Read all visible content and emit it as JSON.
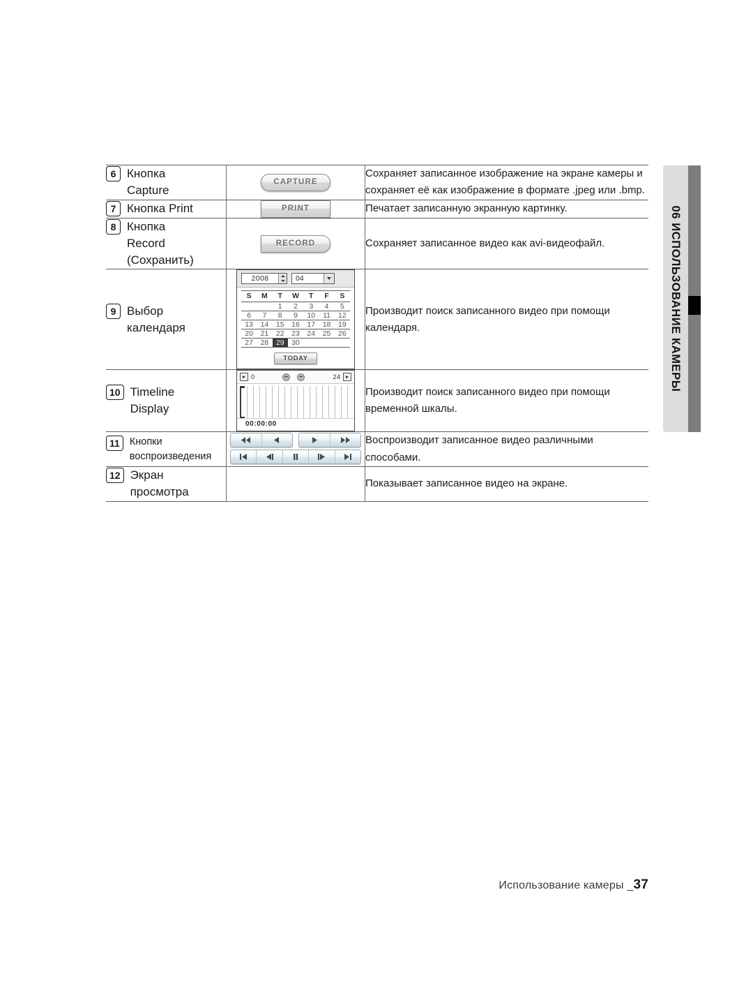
{
  "side_tab": {
    "chapter_number": "06",
    "chapter_title": "ИСПОЛЬЗОВАНИЕ КАМЕРЫ",
    "full_label": "06  ИСПОЛЬЗОВАНИЕ КАМЕРЫ",
    "tab_color": "#dcdcdc",
    "bar_color": "#7d7d7d",
    "marker_color": "#000000"
  },
  "table": {
    "rows": [
      {
        "number": "6",
        "label_lines": [
          "Кнопка",
          "Capture"
        ],
        "visual": "capture-button",
        "button_label": "CAPTURE",
        "description": "Сохраняет записанное изображение на экране камеры и сохраняет её как изображение в формате .jpeg или .bmp."
      },
      {
        "number": "7",
        "label_lines": [
          "Кнопка Print"
        ],
        "visual": "print-button",
        "button_label": "PRINT",
        "description": "Печатает записанную экранную картинку."
      },
      {
        "number": "8",
        "label_lines": [
          "Кнопка",
          "Record",
          "(Сохранить)"
        ],
        "visual": "record-button",
        "button_label": "RECORD",
        "description": "Сохраняет записанное видео как avi-видеофайл."
      },
      {
        "number": "9",
        "label_lines": [
          "Выбор",
          "календаря"
        ],
        "visual": "calendar-widget",
        "description": "Производит поиск записанного видео при помощи календаря."
      },
      {
        "number": "10",
        "label_lines": [
          "Timeline",
          "Display"
        ],
        "visual": "timeline-widget",
        "description": "Производит поиск записанного видео при помощи временной шкалы."
      },
      {
        "number": "11",
        "label_lines": [
          "Кнопки",
          "воспроизведения"
        ],
        "label_small": true,
        "visual": "playback-controls",
        "description": "Воспроизводит записанное видео различными способами."
      },
      {
        "number": "12",
        "label_lines": [
          "Экран",
          "просмотра"
        ],
        "visual": "none",
        "description": "Показывает записанное видео на экране."
      }
    ]
  },
  "calendar": {
    "year": "2008",
    "month": "04",
    "weekday_headers": [
      "S",
      "M",
      "T",
      "W",
      "T",
      "F",
      "S"
    ],
    "weeks": [
      [
        "",
        "",
        "1",
        "2",
        "3",
        "4",
        "5"
      ],
      [
        "6",
        "7",
        "8",
        "9",
        "10",
        "11",
        "12"
      ],
      [
        "13",
        "14",
        "15",
        "16",
        "17",
        "18",
        "19"
      ],
      [
        "20",
        "21",
        "22",
        "23",
        "24",
        "25",
        "26"
      ],
      [
        "27",
        "28",
        "29",
        "30",
        "",
        "",
        ""
      ]
    ],
    "selected_day": "29",
    "today_button_label": "TODAY"
  },
  "timeline": {
    "start_hour": "0",
    "end_hour": "24",
    "current_time": "00:00:00",
    "left_icon": "play-left-icon",
    "right_icon": "play-right-icon",
    "zoom_in_icon": "zoom-in-icon",
    "zoom_out_icon": "zoom-out-icon"
  },
  "playback": {
    "row1": [
      {
        "name": "rewind-button",
        "icon": "rewind-icon"
      },
      {
        "name": "step-backward-button",
        "icon": "triangle-left-icon"
      },
      {
        "name": "play-button",
        "icon": "triangle-right-icon"
      },
      {
        "name": "fast-forward-button",
        "icon": "fast-forward-icon"
      }
    ],
    "row2": [
      {
        "name": "skip-to-start-button",
        "icon": "skip-start-icon"
      },
      {
        "name": "previous-frame-button",
        "icon": "prev-frame-icon"
      },
      {
        "name": "pause-button",
        "icon": "pause-icon"
      },
      {
        "name": "next-frame-button",
        "icon": "next-frame-icon"
      },
      {
        "name": "skip-to-end-button",
        "icon": "skip-end-icon"
      }
    ]
  },
  "footer": {
    "text": "Использование камеры _",
    "page_number": "37"
  }
}
